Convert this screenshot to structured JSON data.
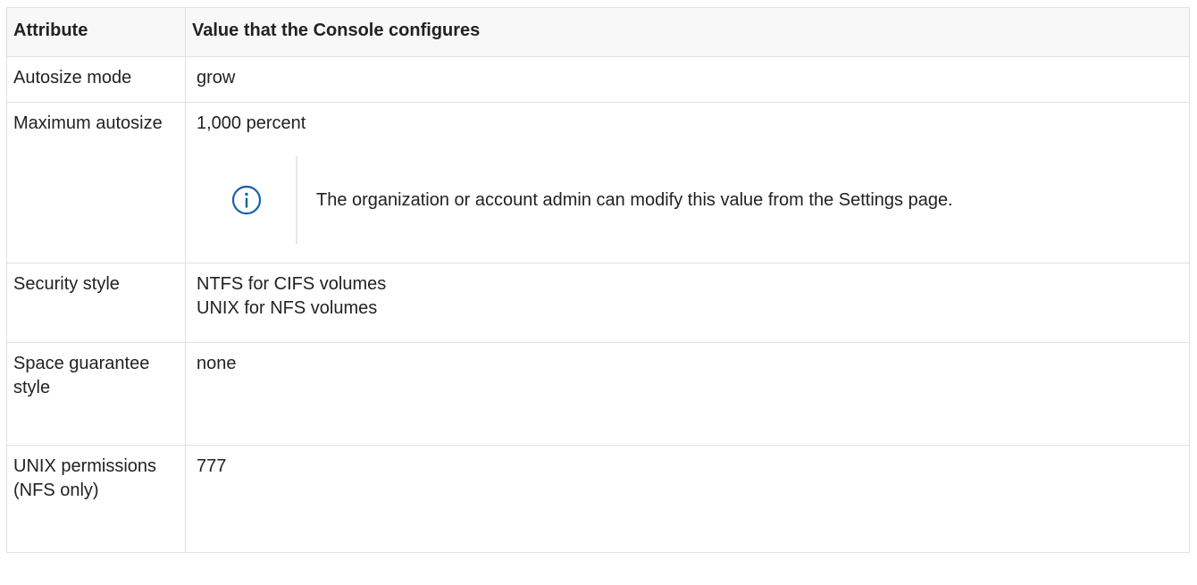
{
  "table": {
    "headers": [
      "Attribute",
      "Value that the Console configures"
    ],
    "rows": [
      {
        "attribute": "Autosize mode",
        "value": "grow"
      },
      {
        "attribute": "Maximum autosize",
        "value": "1,000 percent",
        "note": {
          "icon": "info-icon",
          "text": "The organization or account admin can modify this value from the Settings page."
        }
      },
      {
        "attribute": "Security style",
        "value_lines": [
          "NTFS for CIFS volumes",
          "UNIX for NFS volumes"
        ]
      },
      {
        "attribute": "Space guarantee style",
        "value": "none"
      },
      {
        "attribute": "UNIX permissions (NFS only)",
        "value": "777"
      }
    ]
  },
  "colors": {
    "border": "#e1e1e1",
    "header_background": "#f8f8f8",
    "info_icon": "#1a5fa8",
    "text": "#222222"
  }
}
